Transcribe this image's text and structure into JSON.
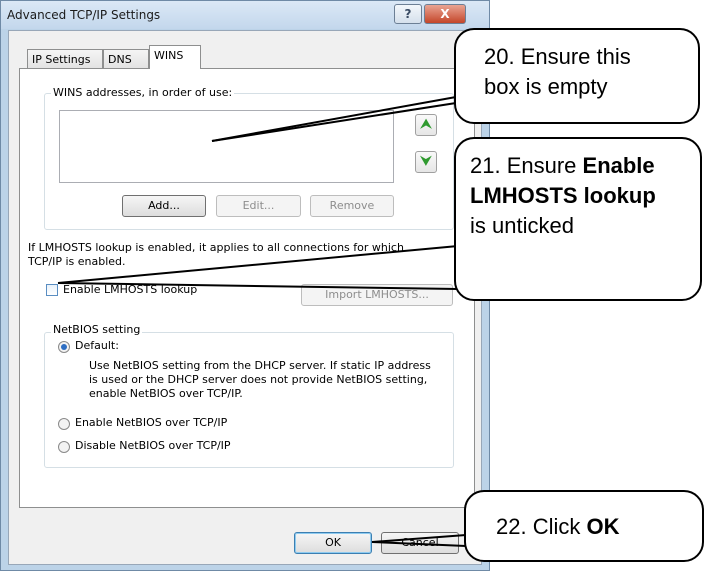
{
  "window": {
    "title": "Advanced TCP/IP Settings",
    "help_glyph": "?",
    "close_glyph": "X"
  },
  "tabs": [
    {
      "label": "IP Settings",
      "active": false
    },
    {
      "label": "DNS",
      "active": false
    },
    {
      "label": "WINS",
      "active": true
    }
  ],
  "wins": {
    "group_label": "WINS addresses, in order of use:",
    "up_arrow": "⮝",
    "down_arrow": "⮟",
    "add_label": "Add...",
    "edit_label": "Edit...",
    "remove_label": "Remove"
  },
  "lmhosts": {
    "info_line1": "If LMHOSTS lookup is enabled, it applies to all connections for which",
    "info_line2": "TCP/IP is enabled.",
    "checkbox_label": "Enable LMHOSTS lookup",
    "checked": false,
    "import_label": "Import LMHOSTS..."
  },
  "netbios": {
    "group_label": "NetBIOS setting",
    "default_label": "Default:",
    "default_desc1": "Use NetBIOS setting from the DHCP server. If static IP address",
    "default_desc2": "is used or the DHCP server does not provide NetBIOS setting,",
    "default_desc3": "enable NetBIOS over TCP/IP.",
    "enable_label": "Enable NetBIOS over TCP/IP",
    "disable_label": "Disable NetBIOS over TCP/IP",
    "selected": "Default"
  },
  "footer": {
    "ok_label": "OK",
    "cancel_label": "Cancel"
  },
  "callouts": {
    "c20_line1": "20. Ensure this",
    "c20_line2": "box is empty",
    "c21_prefix": "21. Ensure ",
    "c21_bold1": "Enable",
    "c21_bold2": "LMHOSTS lookup",
    "c21_suffix": "is unticked",
    "c22_prefix": "22. Click ",
    "c22_bold": "OK"
  }
}
